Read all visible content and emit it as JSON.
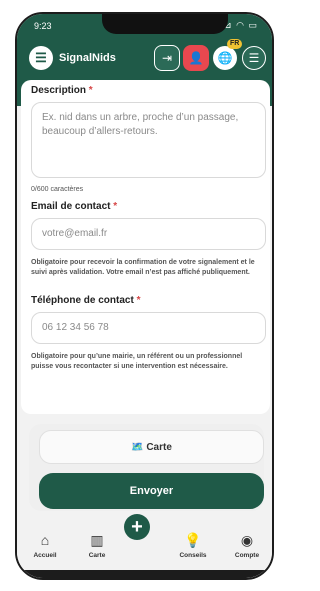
{
  "status": {
    "time": "9:23",
    "icons": "⊿ ≋ ⊿ ◠ ▭"
  },
  "header": {
    "app_name": "SignalNids",
    "language_badge": "FR"
  },
  "form": {
    "description": {
      "label": "Description",
      "required_mark": "*",
      "placeholder": "Ex. nid dans un arbre, proche d’un passage, beaucoup d’allers-retours.",
      "counter": "0/600 caractères"
    },
    "email": {
      "label": "Email de contact",
      "required_mark": "*",
      "placeholder": "votre@email.fr",
      "hint": "Obligatoire pour recevoir la confirmation de votre signalement et le suivi après validation. Votre email n’est pas affiché publiquement."
    },
    "phone": {
      "label": "Téléphone de contact",
      "required_mark": "*",
      "placeholder": "06 12 34 56 78",
      "hint": "Obligatoire pour qu’une mairie, un référent ou un professionnel puisse vous recontacter si une intervention est nécessaire."
    }
  },
  "actions": {
    "map_label": "🗺️ Carte",
    "submit_label": "Envoyer"
  },
  "nav": {
    "items": [
      {
        "label": "Accueil",
        "icon": "home-icon"
      },
      {
        "label": "Carte",
        "icon": "map-icon"
      },
      {
        "label": "Conseils",
        "icon": "lightbulb-icon"
      },
      {
        "label": "Compte",
        "icon": "account-icon"
      }
    ]
  }
}
